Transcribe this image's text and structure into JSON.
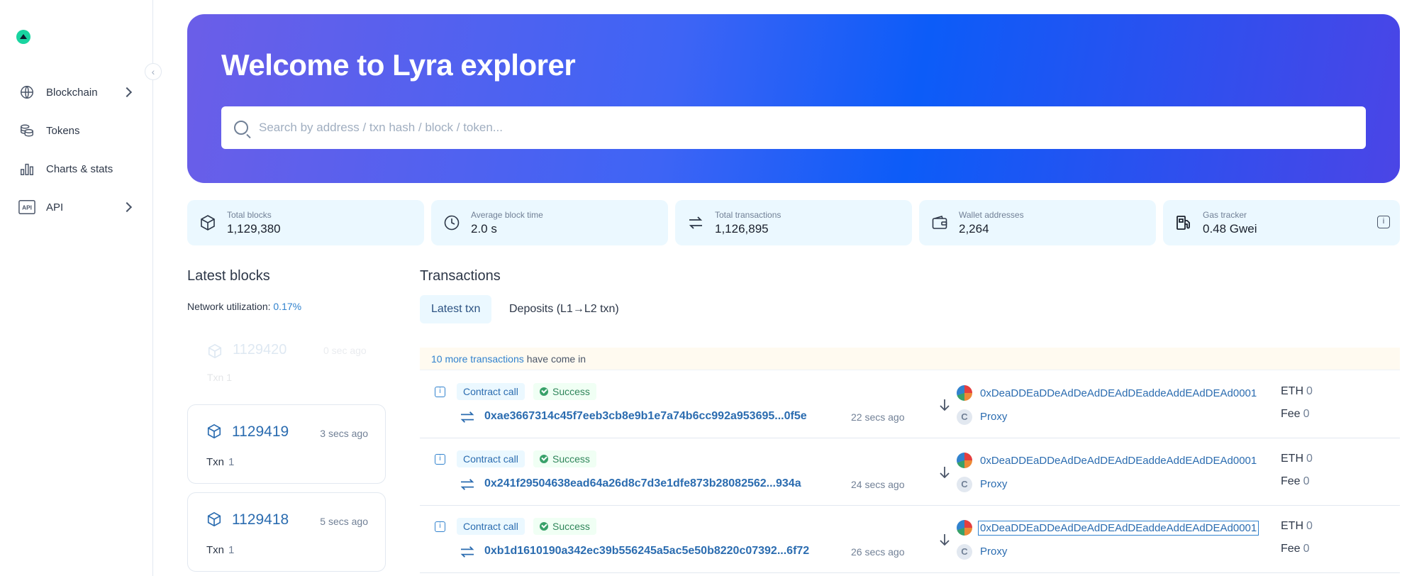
{
  "hero": {
    "title": "Welcome to Lyra explorer",
    "search_placeholder": "Search by address / txn hash / block / token..."
  },
  "sidebar": {
    "items": [
      {
        "label": "Blockchain",
        "icon": "globe-icon",
        "has_submenu": true
      },
      {
        "label": "Tokens",
        "icon": "coins-icon",
        "has_submenu": false
      },
      {
        "label": "Charts & stats",
        "icon": "bar-chart-icon",
        "has_submenu": false
      },
      {
        "label": "API",
        "icon": "api-icon",
        "has_submenu": true
      }
    ]
  },
  "stats": [
    {
      "label": "Total blocks",
      "value": "1,129,380",
      "icon": "cube-icon"
    },
    {
      "label": "Average block time",
      "value": "2.0 s",
      "icon": "clock-icon"
    },
    {
      "label": "Total transactions",
      "value": "1,126,895",
      "icon": "transfer-icon"
    },
    {
      "label": "Wallet addresses",
      "value": "2,264",
      "icon": "wallet-icon"
    },
    {
      "label": "Gas tracker",
      "value": "0.48 Gwei",
      "icon": "gas-pump-icon"
    }
  ],
  "latest_blocks": {
    "title": "Latest blocks",
    "utilization_label": "Network utilization:",
    "utilization_value": "0.17%",
    "txn_label": "Txn",
    "ghost": {
      "number": "1129420",
      "time": "0 sec ago",
      "txn": "1"
    },
    "blocks": [
      {
        "number": "1129419",
        "time": "3 secs ago",
        "txn": "1"
      },
      {
        "number": "1129418",
        "time": "5 secs ago",
        "txn": "1"
      }
    ]
  },
  "transactions": {
    "title": "Transactions",
    "tabs": [
      {
        "label": "Latest txn",
        "active": true
      },
      {
        "label": "Deposits (L1→L2 txn)",
        "active": false
      }
    ],
    "banner_link": "10 more transactions",
    "banner_text": "have come in",
    "eth_label": "ETH",
    "fee_label": "Fee",
    "to_avatar_letter": "C",
    "rows": [
      {
        "type": "Contract call",
        "status": "Success",
        "hash": "0xae3667314c45f7eeb3cb8e9b1e7a74b6cc992a953695...0f5e",
        "time": "22 secs ago",
        "from": "0xDeaDDEaDDeAdDeAdDEAdDEaddeAddEAdDEAd0001",
        "to": "Proxy",
        "eth": "0",
        "fee": "0"
      },
      {
        "type": "Contract call",
        "status": "Success",
        "hash": "0x241f29504638ead64a26d8c7d3e1dfe873b28082562...934a",
        "time": "24 secs ago",
        "from": "0xDeaDDEaDDeAdDeAdDEAdDEaddeAddEAdDEAd0001",
        "to": "Proxy",
        "eth": "0",
        "fee": "0"
      },
      {
        "type": "Contract call",
        "status": "Success",
        "hash": "0xb1d1610190a342ec39b556245a5ac5e50b8220c07392...6f72",
        "time": "26 secs ago",
        "from": "0xDeaDDEaDDeAdDeAdDEAdDEaddeAddEAdDEAd0001",
        "to": "Proxy",
        "eth": "0",
        "fee": "0"
      }
    ]
  },
  "colors": {
    "accent": "#2b6cb0",
    "success": "#38a169",
    "stat_bg": "#ebf8ff"
  }
}
